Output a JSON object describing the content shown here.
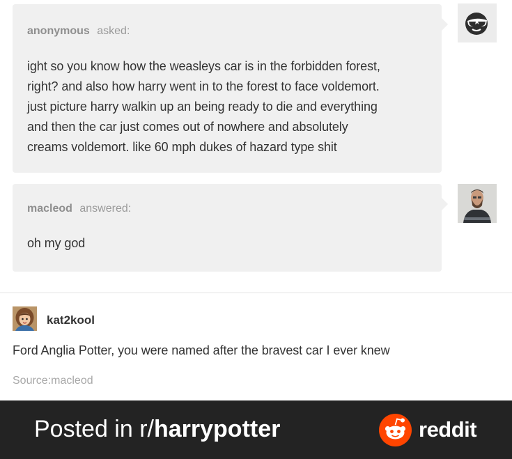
{
  "ask": {
    "author": "anonymous",
    "action": "asked:",
    "lines": [
      "ight so you know how the weasleys car is in the forbidden forest,",
      "right? and also how harry went in to the forest to face voldemort.",
      "just picture harry walkin up an being ready to die and everything",
      "and then the car just comes out of nowhere and absolutely",
      "creams voldemort. like 60 mph dukes of hazard type shit"
    ],
    "avatar_icon": "sunglasses-avatar-icon"
  },
  "answer": {
    "author": "macleod",
    "action": "answered:",
    "text": "oh my god",
    "avatar_icon": "bearded-man-avatar-icon"
  },
  "reblog": {
    "author": "kat2kool",
    "text": "Ford Anglia Potter, you were named after the bravest car I ever knew",
    "source": "Source:macleod",
    "avatar_icon": "cartoon-girl-avatar-icon"
  },
  "footer": {
    "prefix": "Posted in r/",
    "subreddit": "harrypotter",
    "brand": "reddit",
    "brand_color": "#ff4500",
    "background": "#232323"
  }
}
